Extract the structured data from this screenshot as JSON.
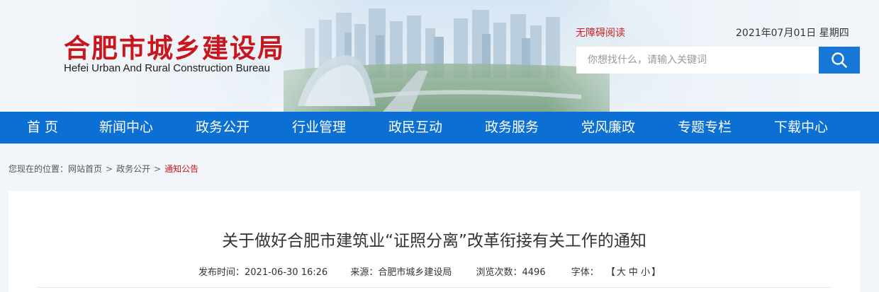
{
  "header": {
    "logo_cn": "合肥市城乡建设局",
    "logo_en": "Hefei Urban And Rural Construction Bureau",
    "accessibility_link": "无障碍阅读",
    "date": "2021年07月01日 星期四",
    "search_placeholder": "你想找什么，请输入关键词",
    "search_icon": "search-icon"
  },
  "nav": {
    "items": [
      {
        "label": "首 页"
      },
      {
        "label": "新闻中心"
      },
      {
        "label": "政务公开"
      },
      {
        "label": "行业管理"
      },
      {
        "label": "政民互动"
      },
      {
        "label": "政务服务"
      },
      {
        "label": "党风廉政"
      },
      {
        "label": "专题专栏"
      },
      {
        "label": "下载中心"
      }
    ]
  },
  "breadcrumb": {
    "prefix": "您现在的位置：",
    "items": [
      "网站首页",
      "政务公开",
      "通知公告"
    ],
    "separator": ">"
  },
  "article": {
    "title": "关于做好合肥市建筑业“证照分离”改革衔接有关工作的通知",
    "publish_label": "发布时间：",
    "publish_time": "2021-06-30 16:26",
    "source_label": "来源：",
    "source": "合肥市城乡建设局",
    "views_label": "浏览次数：",
    "views": "4496",
    "font_label": "字体：",
    "font_open": "【",
    "font_large": "大",
    "font_medium": "中",
    "font_small": "小",
    "font_close": "】"
  },
  "colors": {
    "brand_red": "#c8161d",
    "nav_blue": "#0b6fd3",
    "search_blue": "#1677d6"
  }
}
